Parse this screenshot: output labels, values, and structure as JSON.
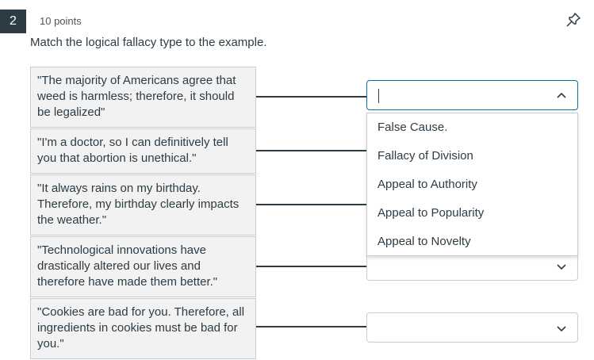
{
  "question": {
    "number": "2",
    "points": "10 points",
    "prompt": "Match the logical fallacy type to the example."
  },
  "answers": [
    {
      "text": "\"The majority of Americans agree that weed is harmless; therefore, it should be legalized\""
    },
    {
      "text": "\"I'm a doctor, so I can definitively tell you that abortion is unethical.\""
    },
    {
      "text": "\"It always rains on my birthday. Therefore, my birthday clearly impacts the weather.\""
    },
    {
      "text": "\"Technological innovations have drastically altered our lives and therefore have made them better.\""
    },
    {
      "text": "\"Cookies are bad for you. Therefore, all ingredients in cookies must be bad for you.\""
    }
  ],
  "selects": [
    {
      "value": "",
      "state": "open"
    },
    {
      "value": "",
      "state": "closed"
    },
    {
      "value": "",
      "state": "closed"
    }
  ],
  "dropdown_options": [
    "False Cause.",
    "Fallacy of Division",
    "Appeal to Authority",
    "Appeal to Popularity",
    "Appeal to Novelty"
  ],
  "icons": {
    "pin": "pin-icon",
    "chevron_up": "chevron-up-icon",
    "chevron_down": "chevron-down-icon"
  }
}
